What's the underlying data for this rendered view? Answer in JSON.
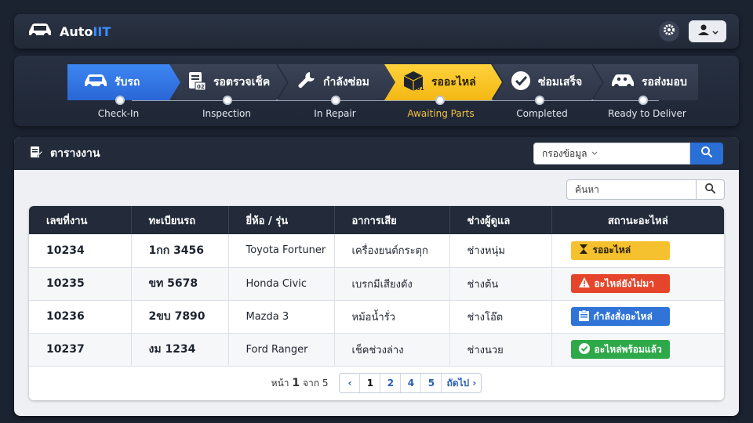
{
  "app": {
    "brand_main": "Auto",
    "brand_accent": "IIT"
  },
  "workflow": {
    "steps": [
      {
        "label": "รับรถ",
        "sub": "Check-In",
        "state": "active-blue",
        "icon": "car-icon"
      },
      {
        "label": "รอตรวจเช็ค",
        "sub": "Inspection",
        "state": "normal",
        "icon": "clipboard-icon",
        "icon_text": "02"
      },
      {
        "label": "กำลังซ่อม",
        "sub": "In Repair",
        "state": "normal",
        "icon": "wrench-icon"
      },
      {
        "label": "รออะไหล่",
        "sub": "Awaiting Parts",
        "state": "active-yellow",
        "icon": "box-icon",
        "icon_text": "01"
      },
      {
        "label": "ซ่อมเสร็จ",
        "sub": "Completed",
        "state": "normal",
        "icon": "check-icon"
      },
      {
        "label": "รอส่งมอบ",
        "sub": "Ready to Deliver",
        "state": "normal",
        "icon": "car-people-icon"
      }
    ]
  },
  "worklist": {
    "title": "ตารางงาน",
    "filter_label": "กรองข้อมูล",
    "search_placeholder": "ค้นหา",
    "columns": [
      "เลขที่งาน",
      "ทะเบียนรถ",
      "ยี่ห้อ / รุ่น",
      "อาการเสีย",
      "ช่างผู้ดูแล",
      "สถานะอะไหล่"
    ],
    "rows": [
      {
        "job": "10234",
        "plate": "1กก 3456",
        "model": "Toyota Fortuner",
        "issue": "เครื่องยนต์กระตุก",
        "tech": "ช่างหนุ่ม",
        "status": "รออะไหล่",
        "status_color": "yellow",
        "status_icon": "hourglass-icon"
      },
      {
        "job": "10235",
        "plate": "ขท 5678",
        "model": "Honda Civic",
        "issue": "เบรกมีเสียงดัง",
        "tech": "ช่างต้น",
        "status": "อะไหล่ยังไม่มา",
        "status_color": "red",
        "status_icon": "warning-icon"
      },
      {
        "job": "10236",
        "plate": "2ขบ 7890",
        "model": "Mazda 3",
        "issue": "หม้อน้ำรั่ว",
        "tech": "ช่างโอ๊ต",
        "status": "กำลังสั่งอะไหล่",
        "status_color": "blue",
        "status_icon": "order-icon"
      },
      {
        "job": "10237",
        "plate": "งม 1234",
        "model": "Ford Ranger",
        "issue": "เช็คช่วงล่าง",
        "tech": "ช่างนวย",
        "status": "อะไหล่พร้อมแล้ว",
        "status_color": "green",
        "status_icon": "check-circle-icon"
      }
    ],
    "pagination": {
      "prefix": "หน้า",
      "current": "1",
      "of_label": "จาก",
      "total": "5",
      "pages": [
        "1",
        "2",
        "4",
        "5"
      ],
      "next_label": "ถัดไป"
    }
  }
}
